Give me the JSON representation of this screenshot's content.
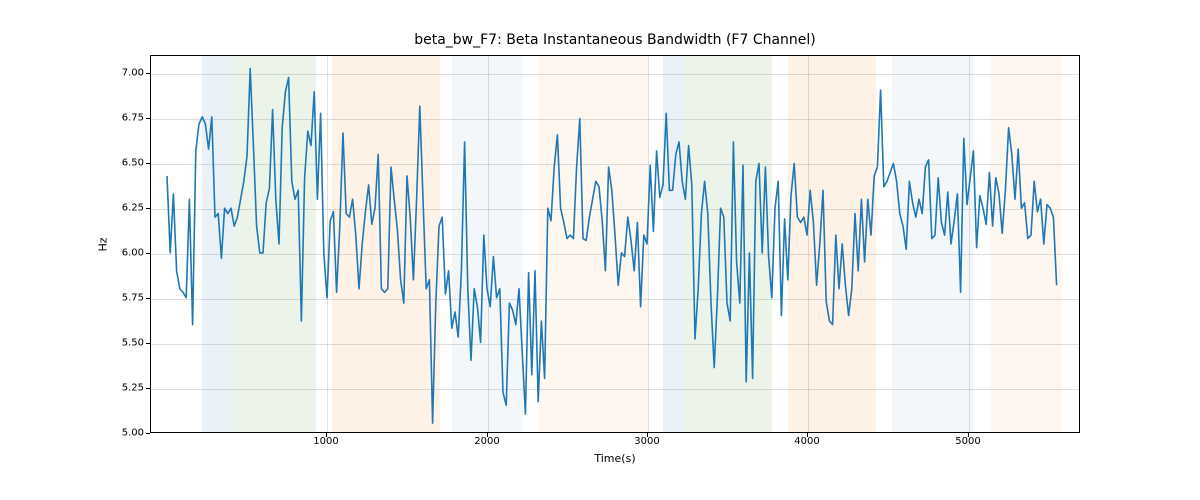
{
  "chart_data": {
    "type": "line",
    "title": "beta_bw_F7: Beta Instantaneous Bandwidth (F7 Channel)",
    "xlabel": "Time(s)",
    "ylabel": "Hz",
    "xlim": [
      -100,
      5700
    ],
    "ylim": [
      5.0,
      7.1
    ],
    "xticks": [
      1000,
      2000,
      3000,
      4000,
      5000
    ],
    "yticks": [
      5.0,
      5.25,
      5.5,
      5.75,
      6.0,
      6.25,
      6.5,
      6.75,
      7.0
    ],
    "ytick_labels": [
      "5.00",
      "5.25",
      "5.50",
      "5.75",
      "6.00",
      "6.25",
      "6.50",
      "6.75",
      "7.00"
    ],
    "bands": [
      {
        "start": 220,
        "end": 420,
        "color": "#d6e3ee"
      },
      {
        "start": 420,
        "end": 930,
        "color": "#d9ead3"
      },
      {
        "start": 1030,
        "end": 1700,
        "color": "#fde5cd"
      },
      {
        "start": 1780,
        "end": 2220,
        "color": "#eaeff6"
      },
      {
        "start": 2320,
        "end": 3000,
        "color": "#fbefe1"
      },
      {
        "start": 3090,
        "end": 3220,
        "color": "#d6e3ee"
      },
      {
        "start": 3220,
        "end": 3770,
        "color": "#d9ead3"
      },
      {
        "start": 3870,
        "end": 4420,
        "color": "#fde5cd"
      },
      {
        "start": 4520,
        "end": 5030,
        "color": "#eaeff6"
      },
      {
        "start": 5130,
        "end": 5580,
        "color": "#fbefe1"
      }
    ],
    "series": [
      {
        "name": "beta_bw_F7",
        "x_start": 0,
        "x_step": 20,
        "values": [
          6.43,
          6.0,
          6.33,
          5.9,
          5.8,
          5.78,
          5.75,
          6.3,
          5.6,
          6.57,
          6.72,
          6.76,
          6.72,
          6.58,
          6.76,
          6.2,
          6.22,
          5.97,
          6.25,
          6.22,
          6.25,
          6.15,
          6.2,
          6.3,
          6.4,
          6.54,
          7.03,
          6.6,
          6.15,
          6.0,
          6.0,
          6.28,
          6.36,
          6.8,
          6.3,
          6.05,
          6.7,
          6.9,
          6.98,
          6.4,
          6.3,
          6.35,
          5.62,
          6.42,
          6.68,
          6.6,
          6.9,
          6.3,
          6.78,
          6.0,
          5.75,
          6.18,
          6.23,
          5.78,
          6.15,
          6.67,
          6.22,
          6.2,
          6.3,
          6.1,
          5.8,
          6.05,
          6.23,
          6.38,
          6.16,
          6.25,
          6.55,
          5.8,
          5.78,
          5.8,
          6.48,
          6.3,
          6.13,
          5.85,
          5.72,
          6.43,
          6.2,
          5.85,
          6.3,
          6.82,
          6.3,
          5.8,
          5.85,
          5.05,
          5.72,
          6.15,
          6.2,
          5.77,
          5.9,
          5.58,
          5.67,
          5.53,
          5.9,
          6.62,
          5.8,
          5.4,
          5.8,
          5.7,
          5.5,
          6.1,
          5.8,
          5.7,
          5.98,
          5.75,
          5.8,
          5.22,
          5.15,
          5.72,
          5.68,
          5.6,
          5.8,
          5.45,
          5.1,
          5.89,
          5.32,
          5.9,
          5.17,
          5.62,
          5.3,
          6.25,
          6.18,
          6.48,
          6.66,
          6.25,
          6.17,
          6.08,
          6.1,
          6.08,
          6.48,
          6.75,
          6.08,
          6.07,
          6.2,
          6.3,
          6.4,
          6.37,
          6.18,
          5.9,
          6.48,
          6.35,
          6.1,
          5.82,
          6.0,
          5.98,
          6.2,
          6.07,
          5.9,
          6.17,
          5.7,
          6.1,
          6.05,
          6.49,
          6.12,
          6.57,
          6.31,
          6.38,
          6.78,
          6.35,
          6.35,
          6.55,
          6.62,
          6.4,
          6.3,
          6.6,
          6.38,
          5.52,
          5.8,
          6.22,
          6.4,
          6.22,
          5.72,
          5.36,
          5.75,
          6.25,
          6.2,
          5.72,
          5.62,
          6.62,
          5.95,
          5.72,
          6.49,
          5.28,
          6.0,
          5.3,
          6.4,
          6.5,
          6.0,
          6.48,
          5.98,
          5.75,
          6.25,
          6.4,
          5.65,
          6.19,
          5.85,
          6.32,
          6.5,
          6.2,
          6.17,
          6.2,
          6.1,
          6.35,
          6.17,
          5.82,
          6.05,
          6.35,
          5.73,
          5.62,
          5.6,
          6.1,
          5.8,
          6.05,
          5.82,
          5.65,
          5.8,
          6.22,
          5.9,
          6.3,
          5.95,
          6.3,
          6.1,
          6.43,
          6.48,
          6.91,
          6.37,
          6.4,
          6.45,
          6.5,
          6.4,
          6.22,
          6.15,
          6.02,
          6.4,
          6.28,
          6.2,
          6.3,
          6.22,
          6.48,
          6.52,
          6.08,
          6.1,
          6.42,
          6.17,
          6.1,
          6.34,
          6.05,
          6.18,
          6.33,
          5.78,
          6.64,
          6.27,
          6.42,
          6.57,
          6.03,
          6.32,
          6.25,
          6.16,
          6.45,
          6.15,
          6.42,
          6.33,
          6.11,
          6.35,
          6.7,
          6.55,
          6.3,
          6.58,
          6.25,
          6.28,
          6.08,
          6.1,
          6.4,
          6.23,
          6.3,
          6.05,
          6.27,
          6.25,
          6.2,
          5.82
        ]
      }
    ]
  }
}
